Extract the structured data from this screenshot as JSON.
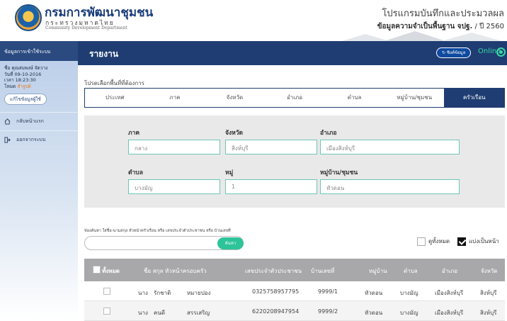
{
  "header": {
    "org_title": "กรมการพัฒนาชุมชน",
    "org_sub": "กระทรวงมหาดไทย",
    "org_en": "Community Development Department",
    "program_title": "โปรแกรมบันทึกและประมวลผล",
    "program_sub_bold": "ข้อมูลความจำเป็นพื้นฐาน จปฐ.",
    "program_sub_year": "/ ปี 2560"
  },
  "sidebar": {
    "heading": "ข้อมูลการเข้าใช้ระบบ",
    "user_name": "ชื่อ คุณสมพงษ์ จัดวาง",
    "date": "วันที่ 09-10-2016",
    "time": "เวลา 18:23:30",
    "mode_label": "โหมด",
    "mode_value": "สำรูปด์",
    "edit_label": "แก้ไขข้อมูลผู้ใช้",
    "items": [
      {
        "label": "กลับหน้าแรก",
        "icon": "home-icon"
      },
      {
        "label": "ออกจากระบบ",
        "icon": "logout-icon"
      }
    ]
  },
  "titlebar": {
    "title": "รายงาน",
    "sync_label": "ซิงค์ข้อมูล",
    "status": "Online",
    "status_color": "#3ad6a2"
  },
  "area": {
    "label": "โปรดเลือกพื้นที่ที่ต้องการ",
    "tabs": [
      "ประเทศ",
      "ภาค",
      "จังหวัด",
      "อำเภอ",
      "ตำบล",
      "หมู่บ้าน/ชุมชน",
      "ครัวเรือน"
    ],
    "active": "ครัวเรือน"
  },
  "filters": {
    "region_label": "ภาค",
    "region_value": "กลาง",
    "province_label": "จังหวัด",
    "province_value": "สิงห์บุรี",
    "district_label": "อำเภอ",
    "district_value": "เมืองสิงห์บุรี",
    "subdistrict_label": "ตำบล",
    "subdistrict_value": "บางมัญ",
    "moo_label": "หมู่",
    "moo_value": "1",
    "village_label": "หมู่บ้าน/ชุมชน",
    "village_value": "หัวดอน"
  },
  "search": {
    "hint": "ช่องค้นหา ใส่ชื่อ-นามสกุล หัวหน้าครัวเรือน หรือ เลขประจำตัวประชาชน หรือ บ้านเลขที่",
    "button": "ค้นหา",
    "option_all": "ดูทั้งหมด",
    "option_paged": "แบ่งเป็นหน้า"
  },
  "table": {
    "columns": [
      "ทั้งหมด",
      "ชื่อ สกุล หัวหน้าครอบครัว",
      "เลขประจำตัวประชาชน",
      "บ้านเลขที่",
      "หมู่บ้าน",
      "ตำบล",
      "อำเภอ",
      "จังหวัด"
    ],
    "rows": [
      {
        "prefix": "นาง",
        "first": "รักชาติ",
        "last": "หมายปอง",
        "id": "0325758957795",
        "house": "9999/1",
        "village": "หัวดอน",
        "subdistrict": "บางมัญ",
        "district": "เมืองสิงห์บุรี",
        "province": "สิงห์บุรี"
      },
      {
        "prefix": "นาง",
        "first": "คนดี",
        "last": "สรรเสริญ",
        "id": "6220208947954",
        "house": "9999/2",
        "village": "หัวดอน",
        "subdistrict": "บางมัญ",
        "district": "เมืองสิงห์บุรี",
        "province": "สิงห์บุรี"
      }
    ]
  }
}
